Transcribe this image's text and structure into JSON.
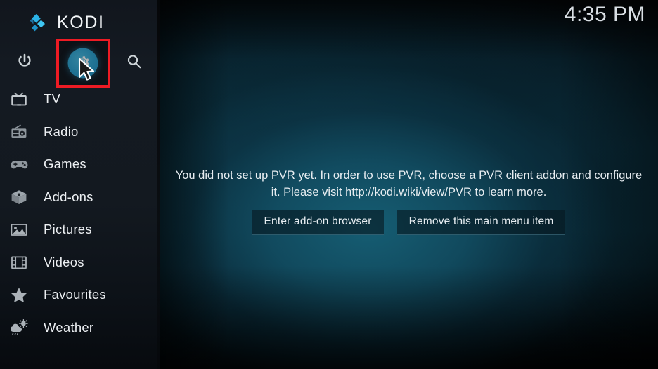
{
  "app": {
    "brand_name": "KODI",
    "logo_icon": "kodi-diamond-logo",
    "clock": "4:35 PM"
  },
  "toolbar": {
    "items": [
      {
        "name": "power",
        "icon": "power-icon",
        "label": "Power",
        "selected": false
      },
      {
        "name": "settings",
        "icon": "gear-icon",
        "label": "Settings",
        "selected": true
      },
      {
        "name": "search",
        "icon": "search-icon",
        "label": "Search",
        "selected": false
      }
    ],
    "highlight_color": "#ee1b24",
    "selected_circle_color": "#2ea4d3"
  },
  "sidebar": {
    "items": [
      {
        "label": "TV",
        "icon": "tv-icon"
      },
      {
        "label": "Radio",
        "icon": "radio-icon"
      },
      {
        "label": "Games",
        "icon": "gamepad-icon"
      },
      {
        "label": "Add-ons",
        "icon": "addons-box-icon"
      },
      {
        "label": "Pictures",
        "icon": "pictures-icon"
      },
      {
        "label": "Videos",
        "icon": "film-strip-icon"
      },
      {
        "label": "Favourites",
        "icon": "star-icon"
      },
      {
        "label": "Weather",
        "icon": "cloud-rain-icon"
      }
    ]
  },
  "main": {
    "message": "You did not set up PVR yet. In order to use PVR, choose a PVR client addon and configure it. Please visit http://kodi.wiki/view/PVR to learn more.",
    "buttons": [
      {
        "label": "Enter add-on browser"
      },
      {
        "label": "Remove this main menu item"
      }
    ]
  },
  "cursor": {
    "icon": "mouse-pointer-arrow"
  }
}
